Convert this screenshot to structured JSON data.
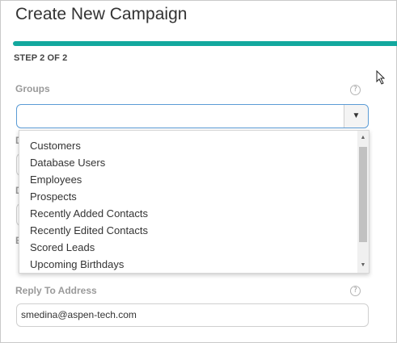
{
  "header": {
    "title": "Create New Campaign",
    "step": "STEP 2 OF 2",
    "progress_fraction": 1.0,
    "accent_color": "#13a89e"
  },
  "groups": {
    "label": "Groups",
    "help_icon": "?",
    "value": "",
    "arrow": "▼",
    "options": [
      "Customers",
      "Database Users",
      "Employees",
      "Prospects",
      "Recently Added Contacts",
      "Recently Edited Contacts",
      "Scored Leads",
      "Upcoming Birthdays"
    ]
  },
  "hidden_labels": [
    "D",
    "D",
    "E"
  ],
  "reply_to": {
    "label": "Reply To Address",
    "help_icon": "?",
    "value": "smedina@aspen-tech.com"
  },
  "colors": {
    "focus_border": "#5b9bd5",
    "label_gray": "#9a9a9a"
  }
}
